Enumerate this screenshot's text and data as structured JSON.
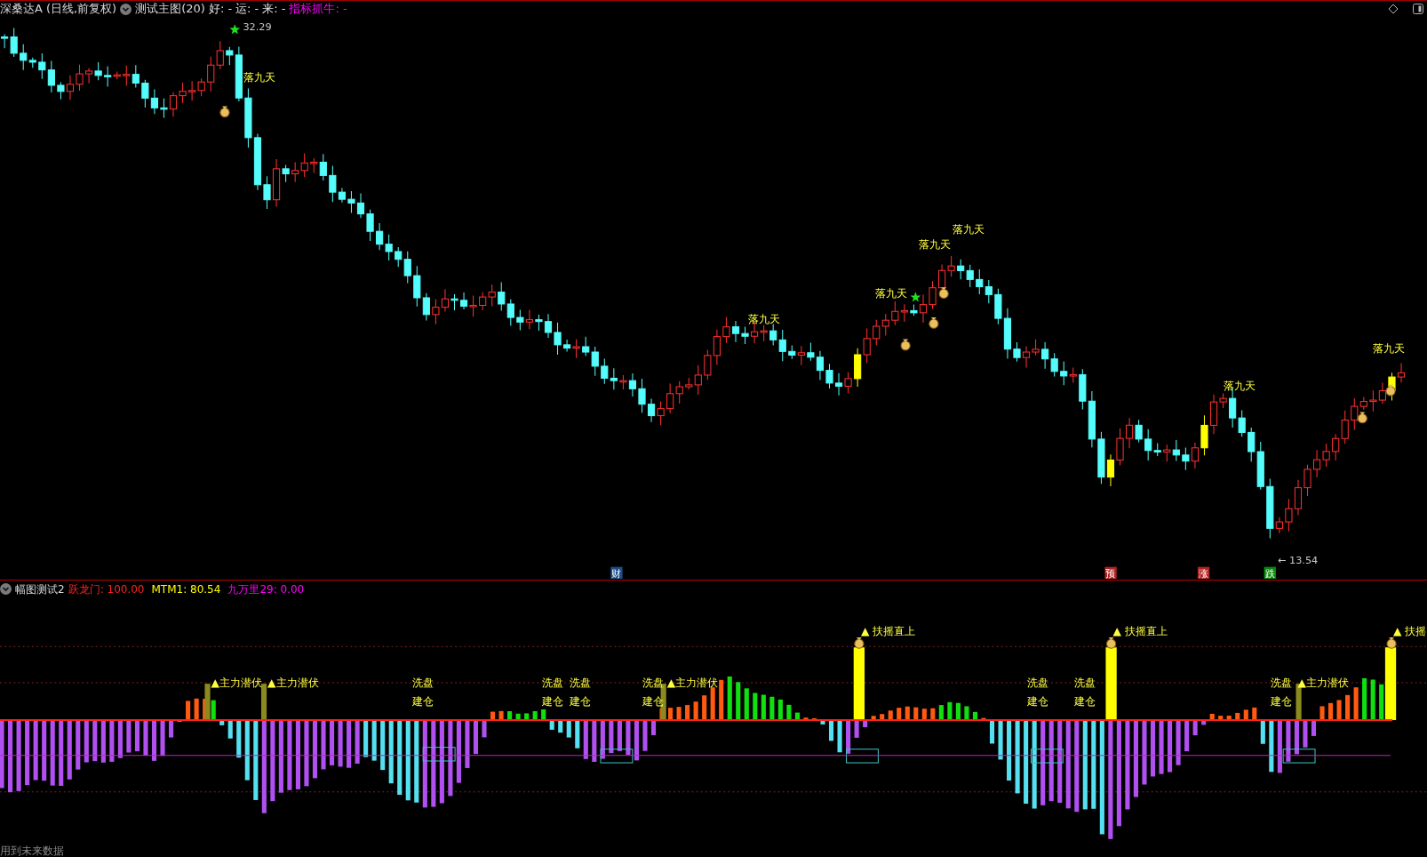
{
  "header": {
    "symbol": "深桑达A",
    "period": "(日线,前复权)",
    "indicator": "测试主图(20)",
    "fields": [
      {
        "label": "好: -",
        "color": "#e0e0e0"
      },
      {
        "label": "运: -",
        "color": "#e0e0e0"
      },
      {
        "label": "来: -",
        "color": "#e0e0e0"
      },
      {
        "label": "指标抓牛: -",
        "color": "#ff00ff"
      }
    ]
  },
  "main_chart": {
    "high_label": "32.29",
    "low_label": "← 13.54",
    "signals": [
      "落九天",
      "落九天",
      "落九天",
      "落九天",
      "落九天",
      "落九天",
      "落九天"
    ],
    "events": [
      {
        "text": "财",
        "color": "#1c4e8a"
      },
      {
        "text": "预",
        "color": "#b22222"
      },
      {
        "text": "涨",
        "color": "#b22222"
      },
      {
        "text": "跌",
        "color": "#0a8a0a"
      }
    ]
  },
  "sub_header": {
    "title": "幅图测试2",
    "fields": [
      {
        "label": "跃龙门: 100.00",
        "color": "#ff2020"
      },
      {
        "label": "MTM1: 80.54",
        "color": "#ffff00"
      },
      {
        "label": "九万里29: 0.00",
        "color": "#ff00ff"
      }
    ]
  },
  "sub_chart": {
    "markers": [
      {
        "kind": "lurk",
        "lines": [
          "▲主力潜伏"
        ]
      },
      {
        "kind": "lurk",
        "lines": [
          "▲主力潜伏"
        ]
      },
      {
        "kind": "wash",
        "lines": [
          "洗盘",
          "建仓"
        ]
      },
      {
        "kind": "wash",
        "lines": [
          "洗盘",
          "建仓"
        ]
      },
      {
        "kind": "wash",
        "lines": [
          "洗盘",
          "建仓"
        ]
      },
      {
        "kind": "wash",
        "lines": [
          "洗盘",
          "建仓"
        ]
      },
      {
        "kind": "lurk",
        "lines": [
          "▲主力潜伏"
        ]
      },
      {
        "kind": "rise",
        "lines": [
          "▲ 扶摇直上"
        ]
      },
      {
        "kind": "wash",
        "lines": [
          "洗盘",
          "建仓"
        ]
      },
      {
        "kind": "wash",
        "lines": [
          "洗盘",
          "建仓"
        ]
      },
      {
        "kind": "rise",
        "lines": [
          "▲ 扶摇直上"
        ]
      },
      {
        "kind": "wash",
        "lines": [
          "洗盘",
          "建仓"
        ]
      },
      {
        "kind": "lurk",
        "lines": [
          "▲主力潜伏"
        ]
      },
      {
        "kind": "rise",
        "lines": [
          "▲ 扶摇"
        ]
      }
    ]
  },
  "footer": "用到未来数据"
}
